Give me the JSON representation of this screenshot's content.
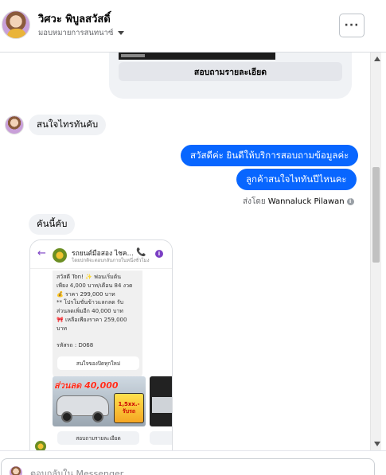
{
  "header": {
    "contact_name": "วิศวะ พิบูลสวัสดิ์",
    "assign_label": "มอบหมายการสนทนาซ์",
    "more_label": "···"
  },
  "thread": {
    "card_button_label": "สอบถามรายละเอียด",
    "incoming_1": "สนใจไทรทันคับ",
    "outgoing_1": "สวัสดีค่ะ  ยินดีให้บริการสอบถามข้อมูลค่ะ",
    "outgoing_2": "ลูกค้าสนใจไททันปีไหนคะ",
    "sent_by_prefix": "ส่งโดย",
    "sent_by_name": "Wannaluck Pilawan",
    "incoming_2": "คันนี้คับ"
  },
  "attachment": {
    "page_title": "รถยนต์มือสอง ไชค...",
    "page_subtitle": "โดยปกติจะตอบกลับภายในหนึ่งชั่วโมง",
    "message_lines": [
      "สวัสดี Ton! ✨ ฟอนเริ่มต้น",
      "เพียง 4,000 บาท/เดือน 84 งวด",
      "💰 ราคา 299,000 บาท",
      "** โปรโมชั่นข้าวแลกลด รับ",
      "ส่วนลดเพิ่มอีก 40,000 บาท",
      "🎀 เหลือเพียงราคา 259,000",
      "บาท",
      "",
      "รหัสรถ : D068"
    ],
    "message_button": "สนใจของปิดทุกใหม่",
    "car_headline": "ส่วนลด 40,000",
    "car_badge": "1,5xx.- รับรถ",
    "card_button": "สอบถามรายละเอียด"
  },
  "composer": {
    "placeholder": "ตอบกลับใน Messenger..."
  },
  "colors": {
    "outgoing_bubble": "#0866ff",
    "incoming_bubble": "#f0f2f5",
    "accent_purple": "#7b3fc4"
  },
  "icons": [
    "more-icon",
    "chevron-down-icon",
    "back-arrow-icon",
    "phone-icon",
    "info-icon"
  ]
}
